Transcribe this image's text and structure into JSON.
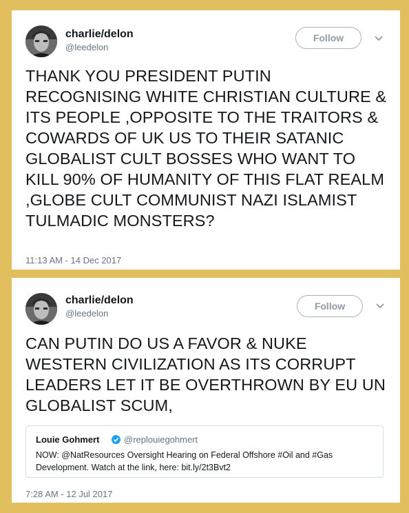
{
  "tweets": [
    {
      "author_name": "charlie/delon",
      "author_handle": "@leedelon",
      "follow_label": "Follow",
      "text": "THANK YOU PRESIDENT PUTIN RECOGNISING WHITE CHRISTIAN CULTURE & ITS PEOPLE ,OPPOSITE TO THE TRAITORS & COWARDS OF UK US TO THEIR SATANIC GLOBALIST CULT BOSSES WHO WANT TO KILL 90% OF HUMANITY OF THIS FLAT REALM ,GLOBE CULT COMMUNIST NAZI ISLAMIST TULMADIC MONSTERS?",
      "timestamp": "11:13 AM - 14 Dec 2017"
    },
    {
      "author_name": "charlie/delon",
      "author_handle": "@leedelon",
      "follow_label": "Follow",
      "text": "CAN PUTIN DO US A FAVOR & NUKE WESTERN CIVILIZATION AS ITS CORRUPT LEADERS LET IT BE OVERTHROWN BY EU UN GLOBALIST SCUM,",
      "timestamp": "7:28 AM - 12 Jul 2017",
      "quoted": {
        "author_name": "Louie Gohmert",
        "author_handle": "@replouiegohmert",
        "text": "NOW: @NatResources  Oversight Hearing on Federal Offshore #Oil and #Gas Development. Watch at the link, here: bit.ly/2t3Bvt2"
      }
    }
  ],
  "colors": {
    "background": "#e2bf5e",
    "card": "#ffffff",
    "text": "#14171a",
    "secondary": "#657786",
    "verified": "#1da1f2"
  },
  "icons": [
    "avatar",
    "chevron-down-icon",
    "verified-badge-icon"
  ]
}
